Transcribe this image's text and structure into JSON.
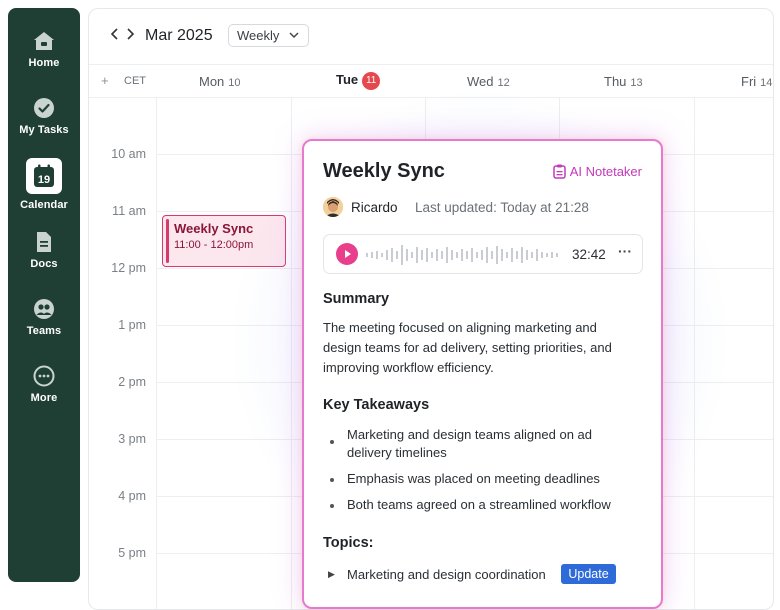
{
  "sidebar": {
    "items": [
      {
        "label": "Home",
        "icon": "home-icon"
      },
      {
        "label": "My Tasks",
        "icon": "check-circle-icon"
      },
      {
        "label": "Calendar",
        "icon": "calendar-icon",
        "badge": "19",
        "active": true
      },
      {
        "label": "Docs",
        "icon": "document-icon"
      },
      {
        "label": "Teams",
        "icon": "team-icon"
      },
      {
        "label": "More",
        "icon": "more-icon"
      }
    ]
  },
  "toolbar": {
    "prev_icon": "chevron-left-icon",
    "next_icon": "chevron-right-icon",
    "month": "Mar 2025",
    "view": "Weekly"
  },
  "calendar": {
    "add_icon": "plus-icon",
    "timezone": "CET",
    "days": [
      {
        "name": "Mon",
        "num": "10",
        "today": false
      },
      {
        "name": "Tue",
        "num": "11",
        "today": true
      },
      {
        "name": "Wed",
        "num": "12",
        "today": false
      },
      {
        "name": "Thu",
        "num": "13",
        "today": false
      },
      {
        "name": "Fri",
        "num": "14",
        "today": false
      }
    ],
    "times": [
      "10 am",
      "11 am",
      "12 pm",
      "1 pm",
      "2 pm",
      "3 pm",
      "4 pm",
      "5 pm"
    ],
    "event": {
      "title": "Weekly Sync",
      "time": "11:00 - 12:00pm"
    }
  },
  "card": {
    "title": "Weekly Sync",
    "notetaker": "AI Notetaker",
    "author": "Ricardo",
    "last_updated": "Last updated: Today at 21:28",
    "duration": "32:42",
    "more": "···",
    "summary_heading": "Summary",
    "summary_text": "The meeting focused on aligning marketing and design teams for ad delivery, setting priorities, and improving workflow efficiency.",
    "takeaways_heading": "Key Takeaways",
    "takeaways": [
      "Marketing and design teams aligned on ad delivery timelines",
      "Emphasis was placed on meeting deadlines",
      "Both teams agreed on a streamlined workflow"
    ],
    "topics_heading": "Topics:",
    "topics": [
      {
        "label": "Marketing and design coordination",
        "tag": "Update"
      }
    ]
  },
  "colors": {
    "sidebar_bg": "#1f3f35",
    "accent_pink": "#e83e8c",
    "today_red": "#e5484d",
    "tag_blue": "#2f6ad9"
  }
}
